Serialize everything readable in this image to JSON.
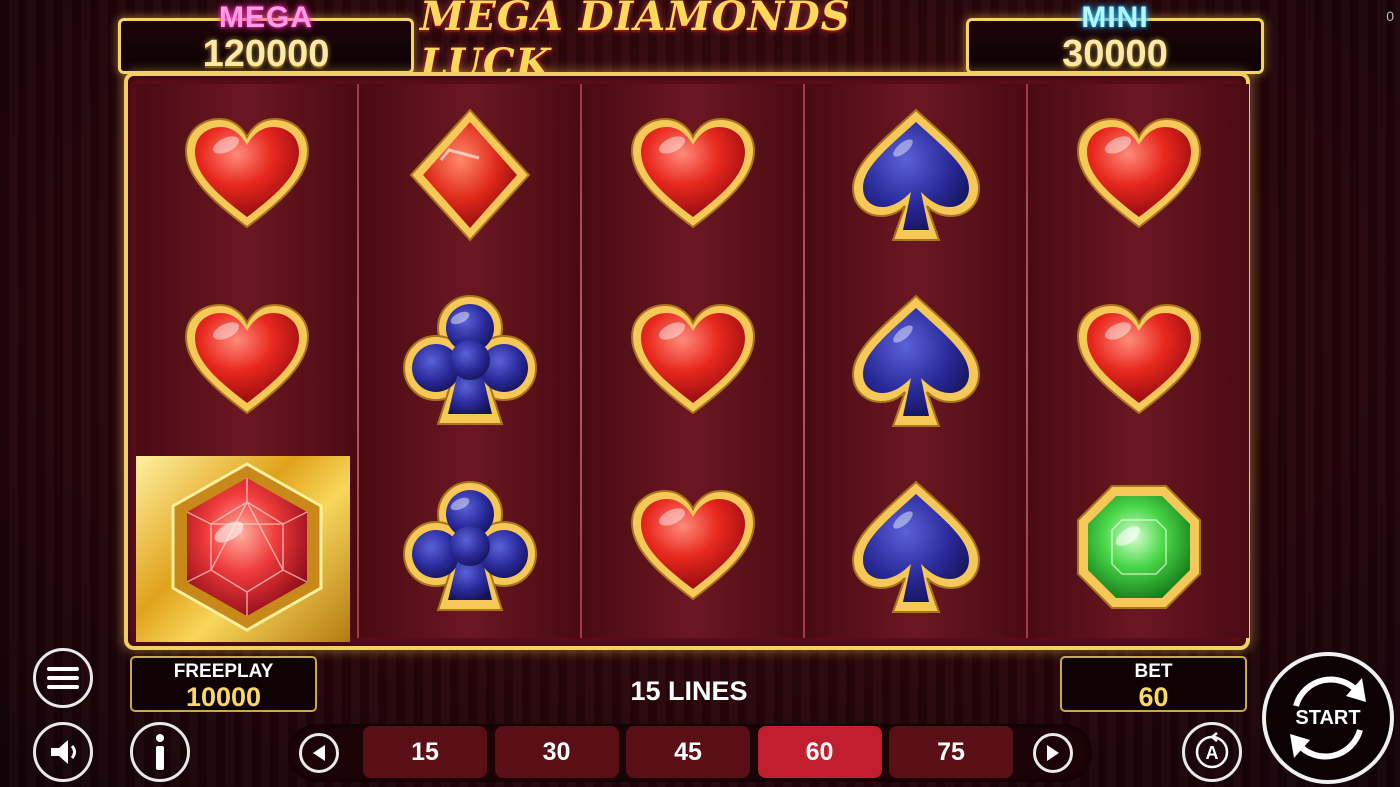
{
  "corner_counter": "0",
  "jackpots": {
    "mega": {
      "label": "MEGA",
      "value": "120000"
    },
    "mini": {
      "label": "MINI",
      "value": "30000"
    }
  },
  "logo": {
    "text": "MEGA DIAMONDS LUCK"
  },
  "reels": [
    [
      "heart",
      "heart",
      "red-gem"
    ],
    [
      "diamond",
      "club",
      "club"
    ],
    [
      "heart",
      "heart",
      "heart"
    ],
    [
      "spade",
      "spade",
      "spade"
    ],
    [
      "heart",
      "heart",
      "green-gem"
    ]
  ],
  "freeplay": {
    "label": "FREEPLAY",
    "value": "10000"
  },
  "lines": {
    "text": "15 LINES"
  },
  "bet": {
    "label": "BET",
    "value": "60"
  },
  "bet_options": [
    "15",
    "30",
    "45",
    "60",
    "75"
  ],
  "bet_selected": "60",
  "buttons": {
    "start_label": "START"
  },
  "icons": {
    "menu": "hamburger-menu-icon",
    "sound": "speaker-icon",
    "info": "info-icon",
    "autoplay": "autoplay-icon",
    "prev": "arrow-left-icon",
    "next": "arrow-right-icon"
  },
  "colors": {
    "gold": "#f2cf62",
    "mega_pink": "#ff2cb4",
    "mini_cyan": "#16b6ff",
    "bet_active": "#c21e2e",
    "reel_bg": "#5a0e16"
  }
}
